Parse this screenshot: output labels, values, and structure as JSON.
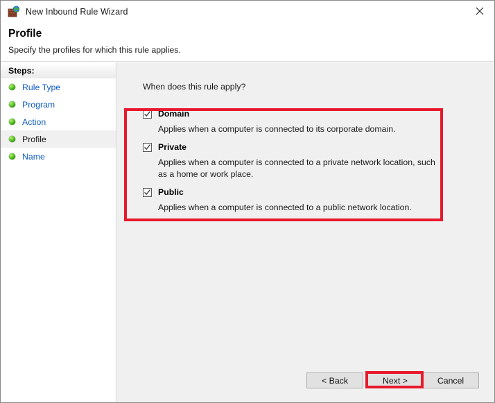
{
  "window": {
    "title": "New Inbound Rule Wizard",
    "icon": "firewall-brick-wall-globe-icon",
    "close_label": "✕"
  },
  "header": {
    "title": "Profile",
    "subtitle": "Specify the profiles for which this rule applies."
  },
  "sidebar": {
    "heading": "Steps:",
    "items": [
      {
        "label": "Rule Type",
        "current": false
      },
      {
        "label": "Program",
        "current": false
      },
      {
        "label": "Action",
        "current": false
      },
      {
        "label": "Profile",
        "current": true
      },
      {
        "label": "Name",
        "current": false
      }
    ]
  },
  "main": {
    "question": "When does this rule apply?",
    "options": [
      {
        "label": "Domain",
        "checked": true,
        "description": "Applies when a computer is connected to its corporate domain."
      },
      {
        "label": "Private",
        "checked": true,
        "description": "Applies when a computer is connected to a private network location, such as a home or work place."
      },
      {
        "label": "Public",
        "checked": true,
        "description": "Applies when a computer is connected to a public network location."
      }
    ]
  },
  "buttons": {
    "back": "< Back",
    "next": "Next >",
    "cancel": "Cancel"
  },
  "annotations": {
    "color": "#e8192c",
    "targets": [
      "profile-options-group",
      "next-button"
    ]
  },
  "colors": {
    "link": "#0d5bbf",
    "content_background": "#f0f0f0",
    "sidebar_background": "#ffffff",
    "annotation_red": "#e8192c",
    "bullet_green": "#4fbf1e"
  }
}
